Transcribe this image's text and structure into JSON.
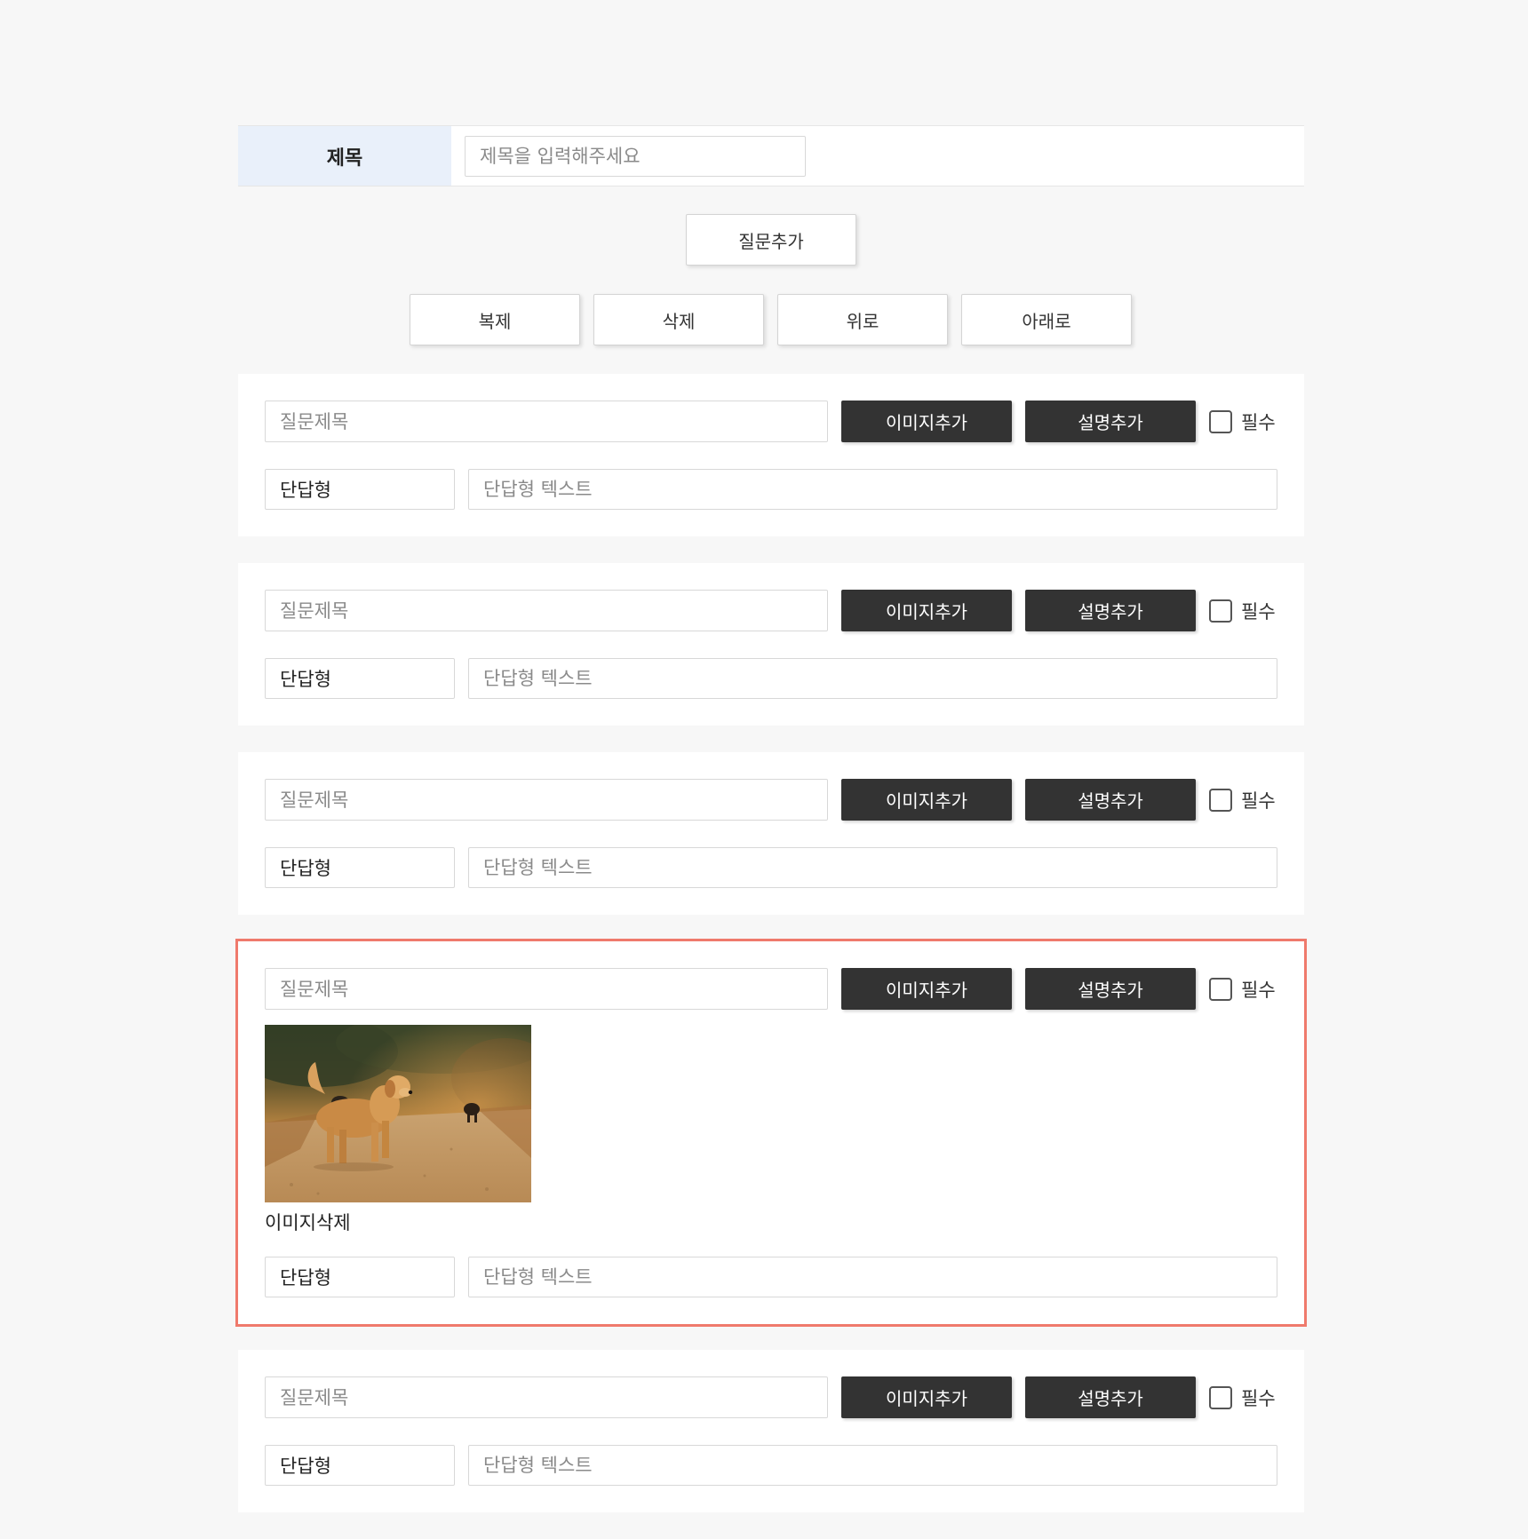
{
  "form": {
    "title_label": "제목",
    "title_placeholder": "제목을 입력해주세요"
  },
  "buttons": {
    "add_question": "질문추가",
    "duplicate": "복제",
    "delete": "삭제",
    "up": "위로",
    "down": "아래로"
  },
  "question": {
    "title_placeholder": "질문제목",
    "add_image": "이미지추가",
    "add_description": "설명추가",
    "required": "필수",
    "type": "단답형",
    "text_placeholder": "단답형 텍스트",
    "delete_image": "이미지삭제"
  },
  "colors": {
    "selected_border": "#ef7a6c",
    "dark_button": "#333333",
    "title_label_bg": "#e9f0fa"
  }
}
